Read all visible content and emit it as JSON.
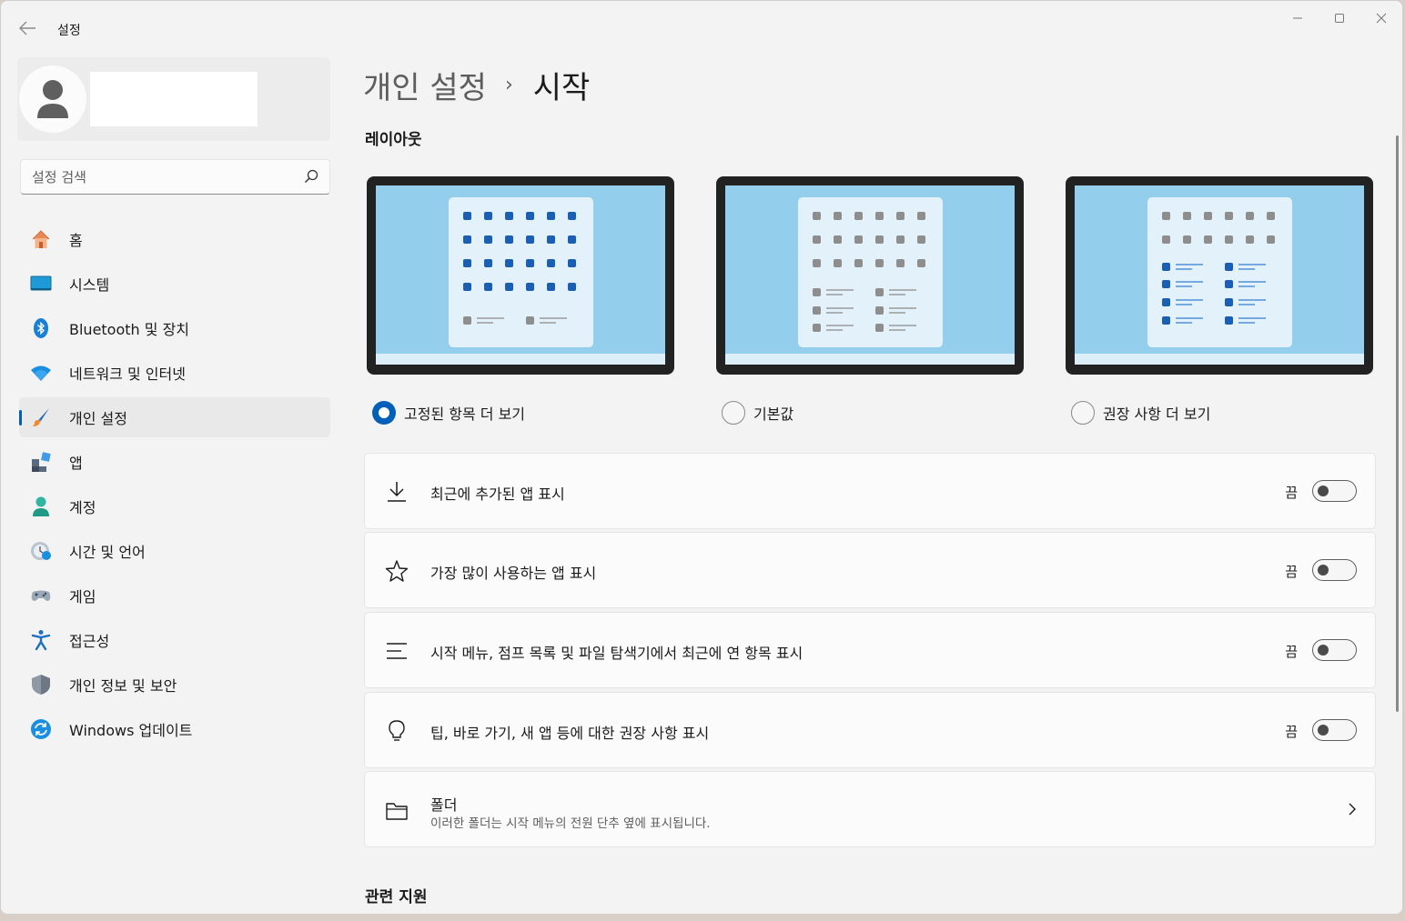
{
  "window": {
    "title": "설정"
  },
  "sidebar": {
    "search_placeholder": "설정 검색",
    "items": [
      {
        "label": "홈",
        "icon": "home-icon"
      },
      {
        "label": "시스템",
        "icon": "system-icon"
      },
      {
        "label": "Bluetooth 및 장치",
        "icon": "bluetooth-icon"
      },
      {
        "label": "네트워크 및 인터넷",
        "icon": "wifi-icon"
      },
      {
        "label": "개인 설정",
        "icon": "brush-icon",
        "active": true
      },
      {
        "label": "앱",
        "icon": "apps-icon"
      },
      {
        "label": "계정",
        "icon": "account-icon"
      },
      {
        "label": "시간 및 언어",
        "icon": "time-language-icon"
      },
      {
        "label": "게임",
        "icon": "gamepad-icon"
      },
      {
        "label": "접근성",
        "icon": "accessibility-icon"
      },
      {
        "label": "개인 정보 및 보안",
        "icon": "shield-icon"
      },
      {
        "label": "Windows 업데이트",
        "icon": "windows-update-icon"
      }
    ]
  },
  "breadcrumb": {
    "parent": "개인 설정",
    "separator": "›",
    "current": "시작"
  },
  "layout": {
    "title": "레이아웃",
    "options": [
      {
        "label": "고정된 항목 더 보기",
        "checked": true
      },
      {
        "label": "기본값",
        "checked": false
      },
      {
        "label": "권장 사항 더 보기",
        "checked": false
      }
    ]
  },
  "settings": [
    {
      "label": "최근에 추가된 앱 표시",
      "state": "끔",
      "icon": "download-icon",
      "on": false
    },
    {
      "label": "가장 많이 사용하는 앱 표시",
      "state": "끔",
      "icon": "star-icon",
      "on": false
    },
    {
      "label": "시작 메뉴, 점프 목록 및 파일 탐색기에서 최근에 연 항목 표시",
      "state": "끔",
      "icon": "list-icon",
      "on": false
    },
    {
      "label": "팁, 바로 가기, 새 앱 등에 대한 권장 사항 표시",
      "state": "끔",
      "icon": "lightbulb-icon",
      "on": false
    }
  ],
  "folders": {
    "title": "폴더",
    "subtitle": "이러한 폴더는 시작 메뉴의 전원 단추 옆에 표시됩니다.",
    "icon": "folder-icon"
  },
  "related": {
    "title": "관련 지원"
  },
  "colors": {
    "accent": "#005fb8",
    "screen": "#93cfed",
    "bezel": "#222222"
  }
}
